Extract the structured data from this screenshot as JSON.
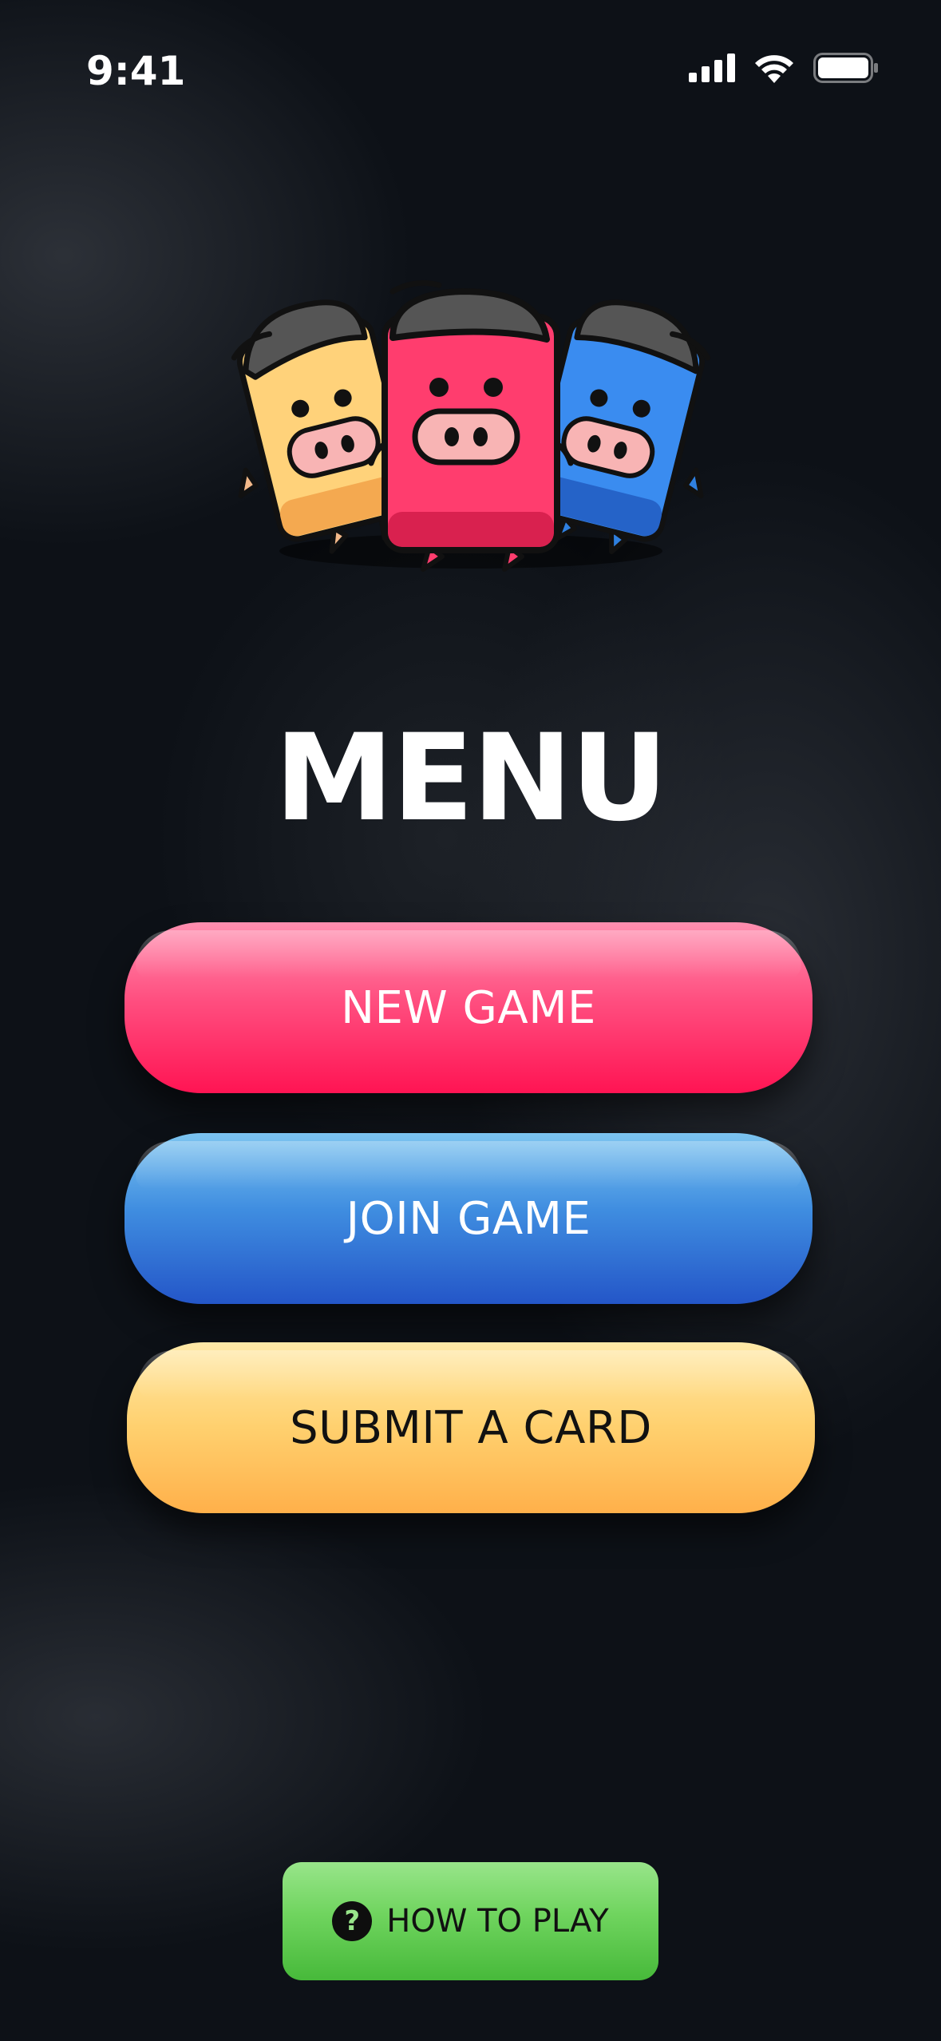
{
  "status_bar": {
    "time": "9:41",
    "icons": [
      "signal-icon",
      "wifi-icon",
      "battery-icon"
    ]
  },
  "mascot": {
    "name": "three-card-pig-characters",
    "colors": [
      "#ffd27a",
      "#ff3d6e",
      "#2f80e0"
    ]
  },
  "title": "MENU",
  "buttons": {
    "new_game": "NEW GAME",
    "join_game": "JOIN GAME",
    "submit_card": "SUBMIT A CARD",
    "how_to_play": "HOW TO PLAY"
  },
  "colors": {
    "new_game": "#ff1453",
    "join_game": "#2f73d8",
    "submit_card": "#ffc35c",
    "how_to_play": "#6fd45e",
    "background": "#0d1117"
  }
}
